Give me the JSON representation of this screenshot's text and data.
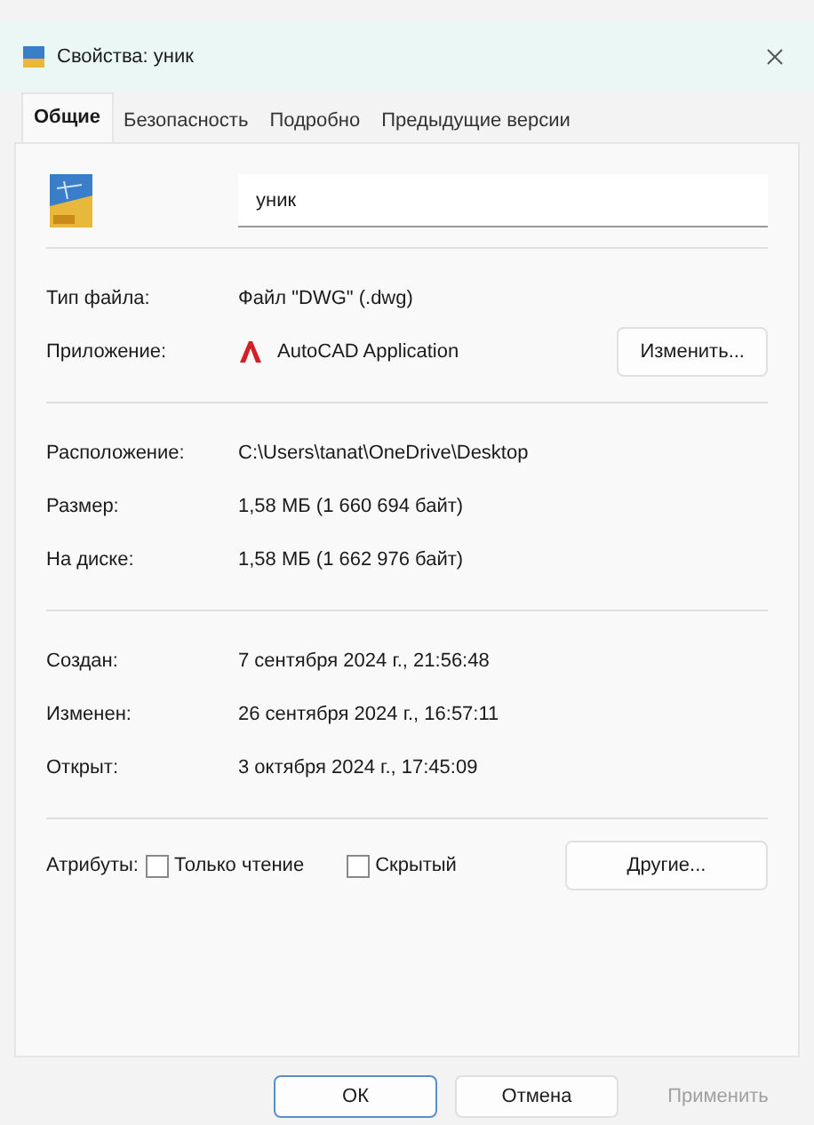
{
  "window": {
    "title": "Свойства: уник"
  },
  "tabs": [
    {
      "label": "Общие",
      "selected": true
    },
    {
      "label": "Безопасность",
      "selected": false
    },
    {
      "label": "Подробно",
      "selected": false
    },
    {
      "label": "Предыдущие версии",
      "selected": false
    }
  ],
  "file_name": {
    "value": "уник"
  },
  "sections": [
    [
      {
        "kind": "text",
        "label": "Тип файла:",
        "value": "Файл \"DWG\" (.dwg)"
      },
      {
        "kind": "app",
        "label": "Приложение:",
        "value": "AutoCAD Application",
        "button": "Изменить..."
      }
    ],
    [
      {
        "kind": "text",
        "label": "Расположение:",
        "value": "C:\\Users\\tanat\\OneDrive\\Desktop"
      },
      {
        "kind": "text",
        "label": "Размер:",
        "value": "1,58 МБ (1 660 694 байт)"
      },
      {
        "kind": "text",
        "label": "На диске:",
        "value": "1,58 МБ (1 662 976 байт)"
      }
    ],
    [
      {
        "kind": "text",
        "label": "Создан:",
        "value": "7 сентября 2024 г., 21:56:48"
      },
      {
        "kind": "text",
        "label": "Изменен:",
        "value": "26 сентября 2024 г., 16:57:11"
      },
      {
        "kind": "text",
        "label": "Открыт:",
        "value": "3 октября 2024 г., 17:45:09"
      }
    ]
  ],
  "attributes": {
    "label": "Атрибуты:",
    "checkboxes": [
      {
        "label": "Только чтение",
        "checked": false
      },
      {
        "label": "Скрытый",
        "checked": false
      }
    ],
    "button": "Другие..."
  },
  "buttons": [
    {
      "label": "ОК",
      "disabled": false,
      "default": true
    },
    {
      "label": "Отмена",
      "disabled": false,
      "default": false
    },
    {
      "label": "Применить",
      "disabled": true,
      "default": false
    }
  ]
}
